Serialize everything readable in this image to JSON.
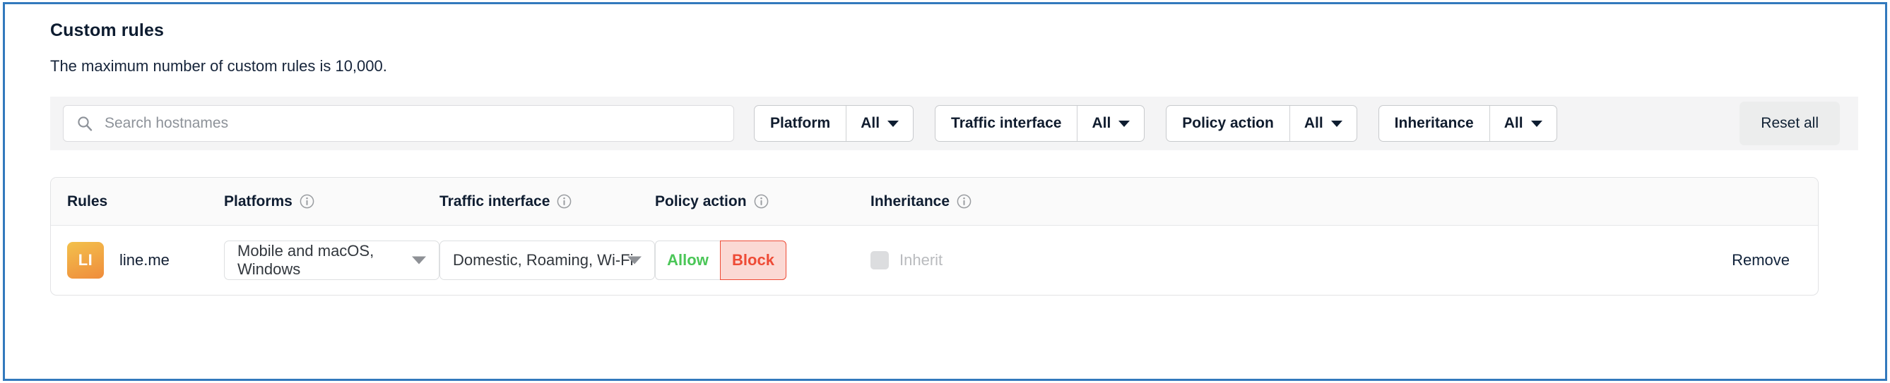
{
  "section": {
    "title": "Custom rules",
    "description": "The maximum number of custom rules is 10,000."
  },
  "search": {
    "placeholder": "Search hostnames",
    "value": "",
    "icon": "search-icon"
  },
  "filters": [
    {
      "label": "Platform",
      "value": "All"
    },
    {
      "label": "Traffic interface",
      "value": "All"
    },
    {
      "label": "Policy action",
      "value": "All"
    },
    {
      "label": "Inheritance",
      "value": "All"
    }
  ],
  "reset_all_label": "Reset all",
  "table": {
    "columns": [
      {
        "label": "Rules",
        "info": false
      },
      {
        "label": "Platforms",
        "info": true
      },
      {
        "label": "Traffic interface",
        "info": true
      },
      {
        "label": "Policy action",
        "info": true
      },
      {
        "label": "Inheritance",
        "info": true
      }
    ],
    "rows": [
      {
        "avatar_initials": "LI",
        "hostname": "line.me",
        "platforms": "Mobile and macOS, Windows",
        "traffic_interface": "Domestic, Roaming, Wi-Fi",
        "policy_allow_label": "Allow",
        "policy_block_label": "Block",
        "policy_selected": "Block",
        "inherit_label": "Inherit",
        "inherit_checked": false,
        "remove_label": "Remove"
      }
    ]
  },
  "colors": {
    "frame_border": "#3279bd",
    "allow_green": "#4ac657",
    "block_red": "#ee4b36",
    "block_bg": "#fbd9d4",
    "avatar_gradient_start": "#f3c14c",
    "avatar_gradient_end": "#ef8c3c",
    "toolbar_bg": "#f4f4f5"
  }
}
